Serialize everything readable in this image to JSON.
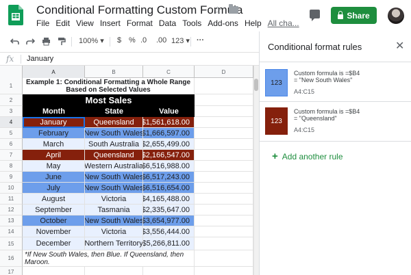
{
  "header": {
    "title": "Conditional Formatting Custom Formula",
    "share_label": "Share",
    "menu": [
      "File",
      "Edit",
      "View",
      "Insert",
      "Format",
      "Data",
      "Tools",
      "Add-ons",
      "Help"
    ],
    "all_changes": "All cha..."
  },
  "toolbar": {
    "zoom": "100%",
    "currency": "$",
    "percent": "%",
    "decrease_decimals": ".0",
    "increase_decimals": ".00",
    "more_formats": "123",
    "more": "···"
  },
  "formula_bar": {
    "fx_label": "fx",
    "value": "January"
  },
  "grid": {
    "columns": [
      "A",
      "B",
      "C",
      "D"
    ],
    "row_numbers": [
      "1",
      "2",
      "3",
      "4",
      "5",
      "6",
      "7",
      "8",
      "9",
      "10",
      "11",
      "12",
      "13",
      "14",
      "15",
      "16",
      "17"
    ],
    "title_line1": "Example 1: Conditional Formatting a Whole Range",
    "title_line2": "Based on Selected Values",
    "table_title": "Most Sales",
    "table_headers": [
      "Month",
      "State",
      "Value"
    ],
    "rows": [
      {
        "month": "January",
        "state": "Queensland",
        "value": "$1,561,618.00"
      },
      {
        "month": "February",
        "state": "New South Wales",
        "value": "$1,666,597.00"
      },
      {
        "month": "March",
        "state": "South Australia",
        "value": "$2,655,499.00"
      },
      {
        "month": "April",
        "state": "Queensland",
        "value": "$2,166,547.00"
      },
      {
        "month": "May",
        "state": "Western Australia",
        "value": "$6,516,988.00"
      },
      {
        "month": "June",
        "state": "New South Wales",
        "value": "$6,517,243.00"
      },
      {
        "month": "July",
        "state": "New South Wales",
        "value": "$6,516,654.00"
      },
      {
        "month": "August",
        "state": "Victoria",
        "value": "$4,165,488.00"
      },
      {
        "month": "September",
        "state": "Tasmania",
        "value": "$2,335,647.00"
      },
      {
        "month": "October",
        "state": "New South Wales",
        "value": "$3,654,977.00"
      },
      {
        "month": "November",
        "state": "Victoria",
        "value": "$3,556,444.00"
      },
      {
        "month": "December",
        "state": "Northern Territory",
        "value": "$5,266,811.00"
      }
    ],
    "note_line1": "*If New South Wales, then Blue. If Queensland, then",
    "note_line2": "Maroon."
  },
  "panel": {
    "title": "Conditional format rules",
    "rules": [
      {
        "preview": "123",
        "formula": "Custom formula is =$B4",
        "value": "= \"New South Wales\"",
        "range": "A4:C15",
        "color": "#6d9eeb"
      },
      {
        "preview": "123",
        "formula": "Custom formula is =$B4",
        "value": "= \"Queensland\"",
        "range": "A4:C15",
        "color": "#85200c"
      }
    ],
    "add_rule": "Add another rule"
  },
  "colors": {
    "blue_fill": "#6d9eeb",
    "maroon_fill": "#85200c",
    "light_fill": "#e8f0fe",
    "share_green": "#1e8e3e",
    "selection_blue": "#1a73e8"
  },
  "icons": [
    "sheets-logo-icon",
    "star-icon",
    "folder-icon",
    "comment-icon",
    "lock-icon",
    "undo-icon",
    "redo-icon",
    "print-icon",
    "paint-format-icon",
    "close-icon",
    "plus-icon"
  ]
}
